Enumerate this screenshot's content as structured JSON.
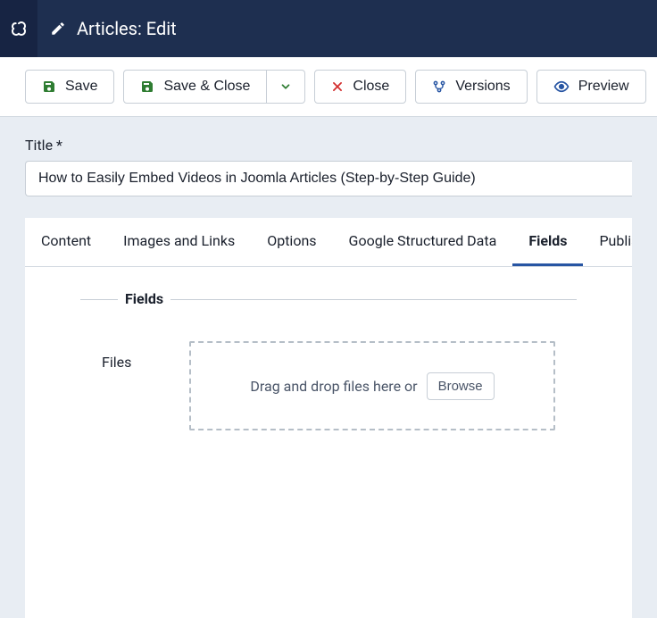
{
  "header": {
    "title": "Articles: Edit"
  },
  "toolbar": {
    "save": "Save",
    "save_close": "Save & Close",
    "close": "Close",
    "versions": "Versions",
    "preview": "Preview"
  },
  "form": {
    "title_label": "Title *",
    "title_value": "How to Easily Embed Videos in Joomla Articles (Step-by-Step Guide)"
  },
  "tabs": {
    "content": "Content",
    "images_links": "Images and Links",
    "options": "Options",
    "gsd": "Google Structured Data",
    "fields": "Fields",
    "publishing": "Publishing"
  },
  "panel": {
    "legend": "Fields",
    "files_label": "Files",
    "dropzone_text": "Drag and drop files here or",
    "browse": "Browse"
  }
}
